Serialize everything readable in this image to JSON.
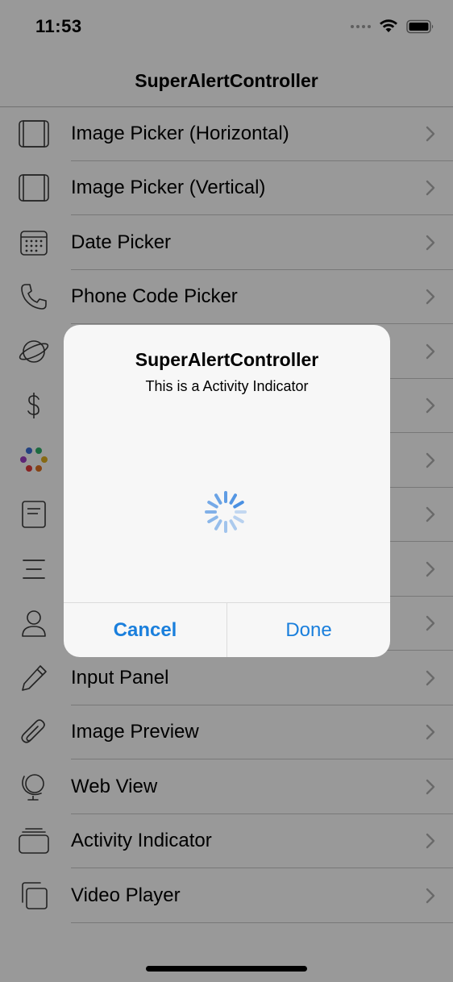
{
  "status_bar": {
    "time": "11:53"
  },
  "nav": {
    "title": "SuperAlertController"
  },
  "list": {
    "items": [
      {
        "label": "Image Picker (Horizontal)",
        "icon": "image-picker-horizontal-icon"
      },
      {
        "label": "Image Picker (Vertical)",
        "icon": "image-picker-vertical-icon"
      },
      {
        "label": "Date Picker",
        "icon": "calendar-icon"
      },
      {
        "label": "Phone Code Picker",
        "icon": "phone-icon"
      },
      {
        "label": "",
        "icon": "planet-icon"
      },
      {
        "label": "",
        "icon": "dollar-icon"
      },
      {
        "label": "",
        "icon": "color-dots-icon"
      },
      {
        "label": "",
        "icon": "note-icon"
      },
      {
        "label": "",
        "icon": "text-lines-icon"
      },
      {
        "label": "",
        "icon": "person-icon"
      },
      {
        "label": "Input Panel",
        "icon": "pencil-icon"
      },
      {
        "label": "Image Preview",
        "icon": "paperclip-icon"
      },
      {
        "label": "Web View",
        "icon": "globe-icon"
      },
      {
        "label": "Activity Indicator",
        "icon": "stack-icon"
      },
      {
        "label": "Video Player",
        "icon": "copy-icon"
      }
    ]
  },
  "alert": {
    "title": "SuperAlertController",
    "message": "This is a Activity Indicator",
    "cancel_label": "Cancel",
    "done_label": "Done"
  },
  "colors": {
    "accent": "#1a7fdc",
    "spinner": "#4a90e2",
    "icon_gray": "#3a3a3a"
  }
}
